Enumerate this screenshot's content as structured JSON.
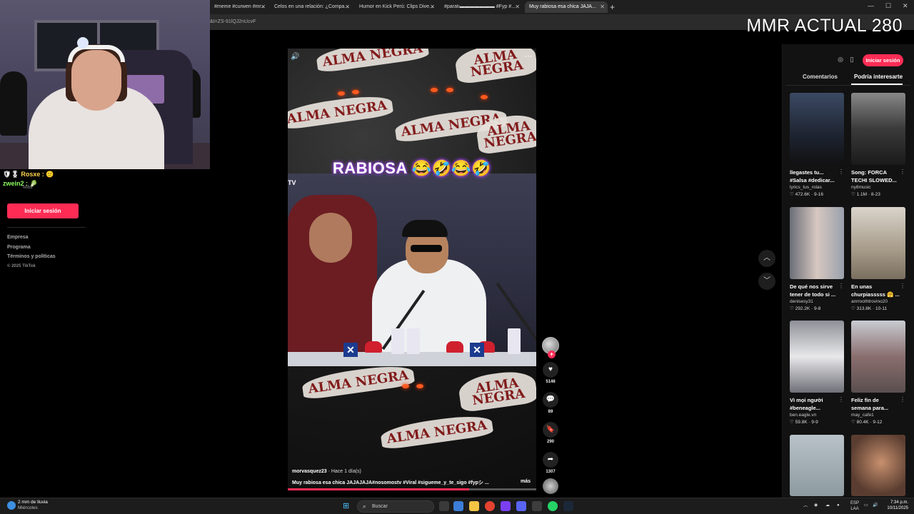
{
  "browser": {
    "tabs": [
      {
        "label": "#meme #curwen #mr..."
      },
      {
        "label": "Celos en una relación: ¿Compa..."
      },
      {
        "label": "Humor en Kick Perú: Clips Dive..."
      },
      {
        "label": "#paratı▬▬▬▬▬▬▬ #Fyp #..."
      },
      {
        "label": "Muy rabiosa esa chica JAJA..."
      }
    ],
    "url_fragment": "&t=ZS-91lQJ2nUcvF",
    "overlay_text": "MMR ACTUAL 280"
  },
  "chat": {
    "line1_user": "Rosxe :",
    "line2_user": "zwein2 :",
    "mas": "Más"
  },
  "left": {
    "login_label": "Iniciar sesión",
    "links": [
      "Empresa",
      "Programa",
      "Términos y políticas"
    ],
    "copyright": "© 2025 TikTok"
  },
  "video": {
    "banner": "RABIOSA 😂🤣😂🤣",
    "tv_logo": "TV",
    "watermark": "ALMA NEGRA",
    "author": "morvasquez23",
    "time": " · Hace 1 día(s)",
    "description": "Muy rabiosa esa chica JAJAJAJA#nosomostv #Viral #sigueme_y_te_sigo #fypシ ...",
    "more": "más",
    "progress": 0.73,
    "likes": "5146",
    "comments": "89",
    "saves": "290",
    "shares": "1307"
  },
  "right_panel": {
    "login_label": "Iniciar sesión",
    "tab_comments": "Comentarios",
    "tab_interest": "Podría interesarte",
    "cards": [
      {
        "title": "llegastes tu... #Salsa #dedicar...",
        "user": "lyrics_tus_rolas",
        "meta": "♡ 472.6K · 9-16"
      },
      {
        "title": "Song: FORCA TECHI SLOWED...",
        "user": "ny8music",
        "meta": "♡ 1.1M · 8-23"
      },
      {
        "title": "De qué nos sirve tener de todo si ...",
        "user": "denisesy31",
        "meta": "♡ 292.2K · 9-8"
      },
      {
        "title": "En unas churpiasssss 🤗 ...",
        "user": "anrroothtrovino20",
        "meta": "♡ 313.8K · 10-11"
      },
      {
        "title": "Vì mọi người #beneagle...",
        "user": "ben.eagle.vn",
        "meta": "♡ 59.8K · 9-9"
      },
      {
        "title": "Feliz fin de semana para...",
        "user": "may_cafe1",
        "meta": "♡ 80.4K · 9-12"
      }
    ]
  },
  "taskbar": {
    "weather_title": "2 mm de lluvia",
    "weather_sub": "Miércoles",
    "search_label": "Buscar",
    "lang": "ESP",
    "lang_sub": "LAA",
    "time": "7:34 p.m.",
    "date": "10/11/2025"
  }
}
